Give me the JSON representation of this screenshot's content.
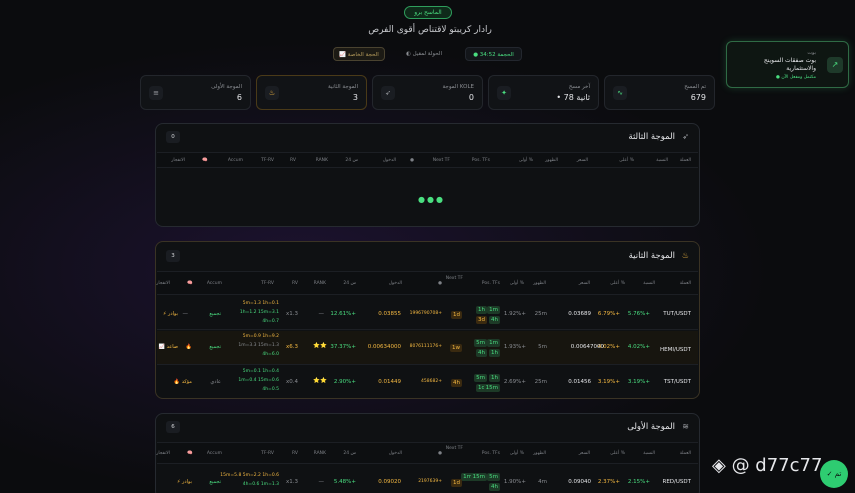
{
  "header": {
    "badge": "الماسح برو",
    "title": "رادار كريبتو لاقتناص أقوى الفرص",
    "manual_check": "📈 الحجة الخاصة",
    "mode": "◐ الحولة لمقيل",
    "timer": "● الحجمة 34:52"
  },
  "bot": {
    "label": "بوت",
    "name": "بوت صفقات السوينج والاستثمارية",
    "status": "● مكتمل ومفعل الآن"
  },
  "stats": [
    {
      "label": "تم المسح",
      "value": "679",
      "icon": "activity-icon"
    },
    {
      "label": "آخر مسح",
      "value": "• 78 ثانية",
      "icon": "pulse-icon"
    },
    {
      "label": "الموجة KOLE",
      "value": "0",
      "icon": "rocket-icon"
    },
    {
      "label": "الموجة الثانية",
      "value": "3",
      "icon": "flame-icon"
    },
    {
      "label": "الموجة الأولى",
      "value": "6",
      "icon": "layers-icon"
    }
  ],
  "columns": [
    "العملة",
    "النسبة",
    "أعلى %",
    "السعر",
    "الظهور",
    "أولى %",
    "Pos. TFs",
    "Next TF",
    "●",
    "الدخول",
    "24 س",
    "RANK",
    "RV",
    "TF-RV",
    "Accum",
    "🧠",
    "الانفجار"
  ],
  "wave3": {
    "title": "الموجة الثالثة",
    "count": "0",
    "loading": "●●●"
  },
  "wave2": {
    "title": "الموجة الثانية",
    "count": "3",
    "rows": [
      {
        "coin": "TUT/USDT",
        "ratio": "5.76%+",
        "high": "6.79%+",
        "price": "0.03689",
        "seen": "25m",
        "first": "1.92%+",
        "tfs": [
          "1h",
          "1m",
          "3d",
          "4h"
        ],
        "next": "1d",
        "entry": "0.03855",
        "entry2": "1996790708+",
        "chg": "12.61%+",
        "rank": "—",
        "rv": "x1.3",
        "tfrv": [
          "5m=1.3 1h=0.1",
          "1h=1.2 15m=3.1",
          "4h=0.7"
        ],
        "accum": "تجميع",
        "exp": "⚡ بوادر"
      },
      {
        "coin": "HEMI/USDT",
        "ratio": "4.02%+",
        "high": "4.02%+",
        "price": "0.00647000",
        "seen": "5m",
        "first": "1.93%+",
        "tfs": [
          "5m",
          "1m",
          "4h",
          "1h"
        ],
        "next": "1w",
        "entry": "0.00634000",
        "entry2": "8076111176+",
        "chg": "37.37%+",
        "rank": "⭐⭐",
        "rv": "x6.3",
        "tfrv": [
          "5m=0.9 1h=9.2",
          "1m=3.3 15m=1.3",
          "4h=6.0"
        ],
        "accum": "تجميع",
        "exp": "📈 صاعد"
      },
      {
        "coin": "TST/USDT",
        "ratio": "3.19%+",
        "high": "3.19%+",
        "price": "0.01456",
        "seen": "25m",
        "first": "2.69%+",
        "tfs": [
          "5m",
          "1h",
          "1d",
          "15m"
        ],
        "next": "4h",
        "entry": "0.01449",
        "entry2": "458682+",
        "chg": "2.90%+",
        "rank": "⭐⭐",
        "rv": "x0.4",
        "tfrv": [
          "5m=0.1 1h=0.4",
          "1m=0.4 15m=0.6",
          "4h=0.5"
        ],
        "accum": "عادي",
        "exp": "🔥 مؤكد"
      }
    ]
  },
  "wave1": {
    "title": "الموجة الأولى",
    "count": "6",
    "rows": [
      {
        "coin": "RED/USDT",
        "ratio": "2.15%+",
        "high": "2.37%+",
        "price": "0.09040",
        "seen": "4m",
        "first": "1.90%+",
        "tfs": [
          "1m",
          "15m",
          "5m",
          "4h"
        ],
        "next": "1d",
        "entry": "0.09020",
        "entry2": "2197639+",
        "chg": "5.48%+",
        "rank": "—",
        "rv": "x1.3",
        "tfrv": [
          "15m=5.8 5m=2.2 1h=0.6",
          "4h=0.6 1m=1.3"
        ],
        "accum": "تجميع",
        "exp": "⚡ بوادر"
      }
    ]
  },
  "watermark": "◈ @ d77c77",
  "fab": "✓ تم"
}
